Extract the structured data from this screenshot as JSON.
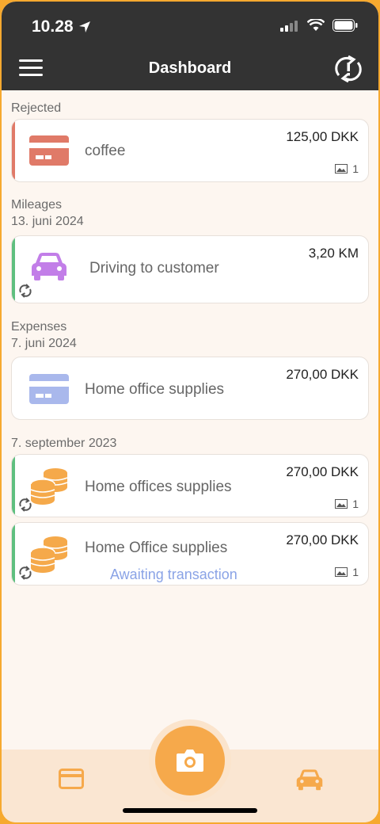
{
  "status": {
    "time": "10.28"
  },
  "header": {
    "title": "Dashboard"
  },
  "sections": {
    "rejected": {
      "label": "Rejected"
    },
    "mileages": {
      "label": "Mileages",
      "date": "13. juni 2024"
    },
    "expenses": {
      "label": "Expenses",
      "date": "7. juni 2024"
    },
    "september": {
      "date": "7. september 2023"
    }
  },
  "cards": [
    {
      "title": "coffee",
      "amount": "125,00 DKK",
      "attachments": "1",
      "stripe": "#e07a68",
      "icon": "card-icon",
      "icon_color": "#e07a68"
    },
    {
      "title": "Driving to customer",
      "amount": "3,20 KM",
      "stripe": "#5fbf7f",
      "icon": "car-icon",
      "icon_color": "#c27ee8"
    },
    {
      "title": "Home office supplies",
      "amount": "270,00 DKK",
      "icon": "card-icon",
      "icon_color": "#a9b8ec"
    },
    {
      "title": "Home offices supplies",
      "amount": "270,00 DKK",
      "attachments": "1",
      "stripe": "#5fbf7f",
      "icon": "coins-icon",
      "icon_color": "#f5a94a"
    },
    {
      "title": "Home Office supplies",
      "amount": "270,00 DKK",
      "attachments": "1",
      "status": "Awaiting transaction",
      "stripe": "#5fbf7f",
      "icon": "coins-icon",
      "icon_color": "#f5a94a"
    }
  ],
  "bottom_nav": {
    "left": "card-icon",
    "center": "camera-icon",
    "right": "car-icon",
    "accent": "#f6a94b"
  }
}
